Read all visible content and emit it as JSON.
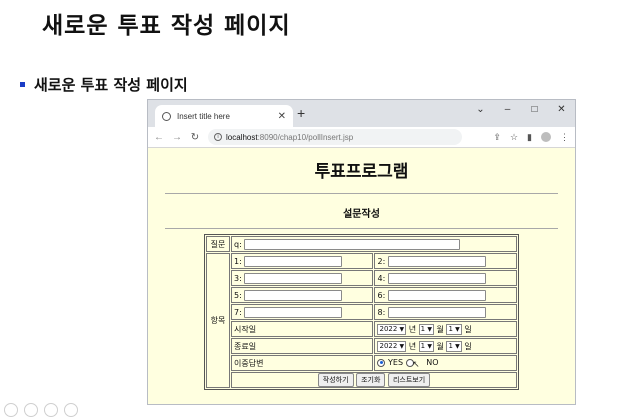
{
  "slide": {
    "title": "새로운 투표 작성 페이지",
    "bullet": "새로운 투표 작성 페이지"
  },
  "browser": {
    "tab_title": "Insert title here",
    "new_tab": "+",
    "url_host": "localhost",
    "url_path": ":8090/chap10/pollInsert.jsp",
    "win_min": "–",
    "win_max": "□",
    "win_close": "✕",
    "win_chevron": "⌄"
  },
  "page": {
    "heading": "투표프로그램",
    "subheading": "설문작성"
  },
  "form": {
    "question_label": "질문",
    "question_prefix": "q:",
    "items_label": "항목",
    "options": [
      {
        "left": "1:",
        "right": "2:"
      },
      {
        "left": "3:",
        "right": "4:"
      },
      {
        "left": "5:",
        "right": "6:"
      },
      {
        "left": "7:",
        "right": "8:"
      }
    ],
    "start_label": "시작일",
    "end_label": "종료일",
    "year_value": "2022",
    "month_value": "1",
    "day_value": "1",
    "year_unit": "년",
    "month_unit": "월",
    "day_unit": "일",
    "dup_label": "이중답변",
    "yes": "YES",
    "no": "NO",
    "submit_btn": "작성하기",
    "reset_btn": "조기화",
    "list_btn": "리스트보기"
  },
  "colors": {
    "page_bg": "#ffffe0",
    "bullet": "#1a3cc6"
  }
}
